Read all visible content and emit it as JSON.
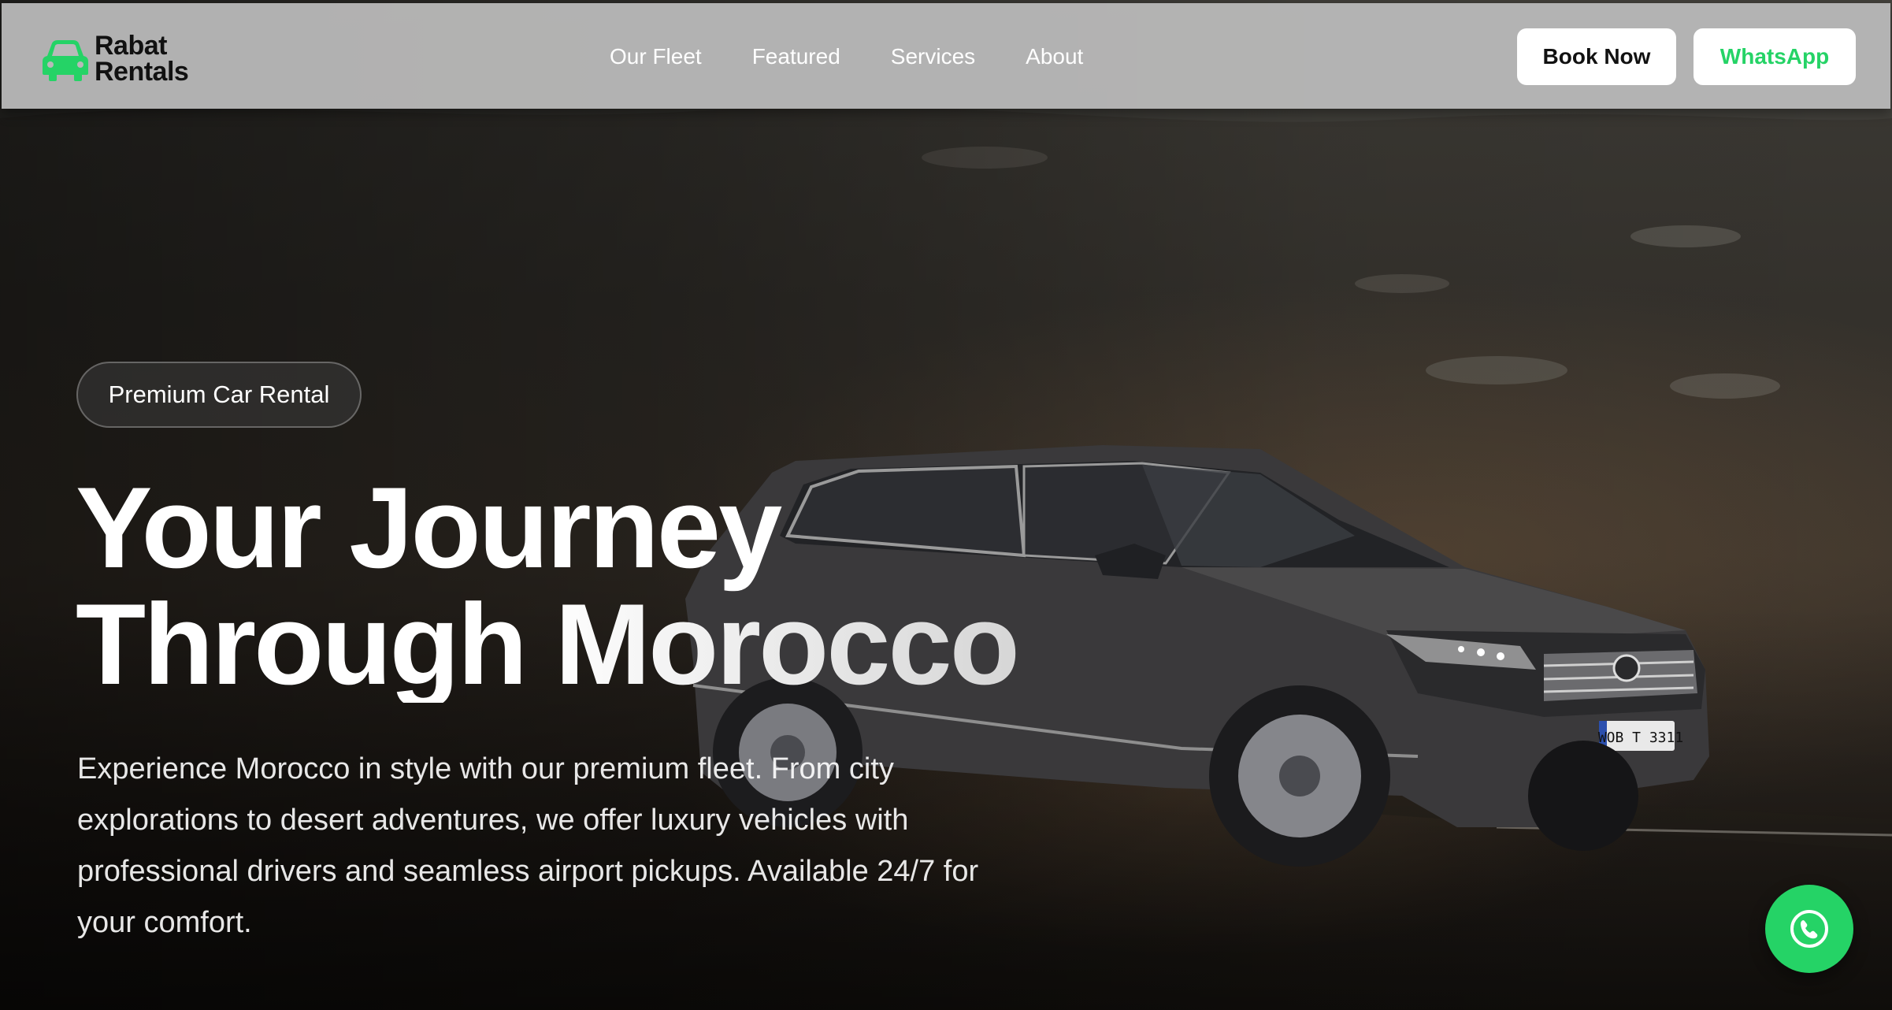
{
  "brand": {
    "line1": "Rabat",
    "line2": "Rentals",
    "icon": "car-icon",
    "color": "#25d366"
  },
  "nav": {
    "links": [
      {
        "label": "Our Fleet"
      },
      {
        "label": "Featured"
      },
      {
        "label": "Services"
      },
      {
        "label": "About"
      }
    ],
    "book_label": "Book Now",
    "whatsapp_label": "WhatsApp"
  },
  "hero": {
    "badge": "Premium Car Rental",
    "headline_line1": "Your Journey",
    "headline_line2": "Through Morocco",
    "description": "Experience Morocco in style with our premium fleet. From city explorations to desert adventures, we offer luxury vehicles with professional drivers and seamless airport pickups. Available 24/7 for your comfort.",
    "plate": "WOB T 3311"
  },
  "fab": {
    "icon": "phone-icon",
    "color": "#25d366"
  }
}
